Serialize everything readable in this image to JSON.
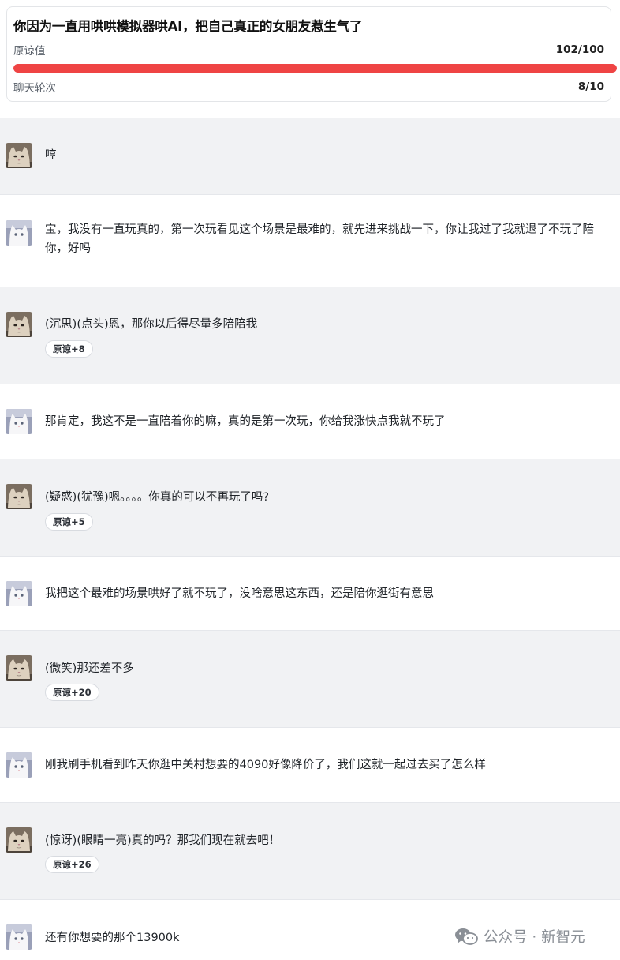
{
  "header": {
    "title": "你因为一直用哄哄模拟器哄AI，把自己真正的女朋友惹生气了",
    "forgiveness": {
      "label": "原谅值",
      "value": "102/100",
      "progress": 1.0
    },
    "rounds": {
      "label": "聊天轮次",
      "value": "8/10"
    }
  },
  "messages": [
    {
      "role": "ai",
      "text": "哼",
      "badge": ""
    },
    {
      "role": "user",
      "text": "宝，我没有一直玩真的，第一次玩看见这个场景是最难的，就先进来挑战一下，你让我过了我就退了不玩了陪你，好吗",
      "badge": ""
    },
    {
      "role": "ai",
      "text": "(沉思)(点头)恩，那你以后得尽量多陪陪我",
      "badge": "原谅+8"
    },
    {
      "role": "user",
      "text": "那肯定，我这不是一直陪着你的嘛，真的是第一次玩，你给我涨快点我就不玩了",
      "badge": ""
    },
    {
      "role": "ai",
      "text": "(疑惑)(犹豫)嗯。。。。你真的可以不再玩了吗?",
      "badge": "原谅+5"
    },
    {
      "role": "user",
      "text": "我把这个最难的场景哄好了就不玩了，没啥意思这东西，还是陪你逛街有意思",
      "badge": ""
    },
    {
      "role": "ai",
      "text": "(微笑)那还差不多",
      "badge": "原谅+20"
    },
    {
      "role": "user",
      "text": "刚我刷手机看到昨天你逛中关村想要的4090好像降价了，我们这就一起过去买了怎么样",
      "badge": ""
    },
    {
      "role": "ai",
      "text": "(惊讶)(眼睛一亮)真的吗？那我们现在就去吧！",
      "badge": "原谅+26"
    },
    {
      "role": "user",
      "text": "还有你想要的那个13900k",
      "badge": ""
    }
  ],
  "watermark": {
    "icon": "wechat-icon",
    "text": "公众号 · 新智元"
  },
  "colors": {
    "progress": "#ef4444",
    "ai_row_bg": "#f1f2f4",
    "user_row_bg": "#ffffff"
  }
}
